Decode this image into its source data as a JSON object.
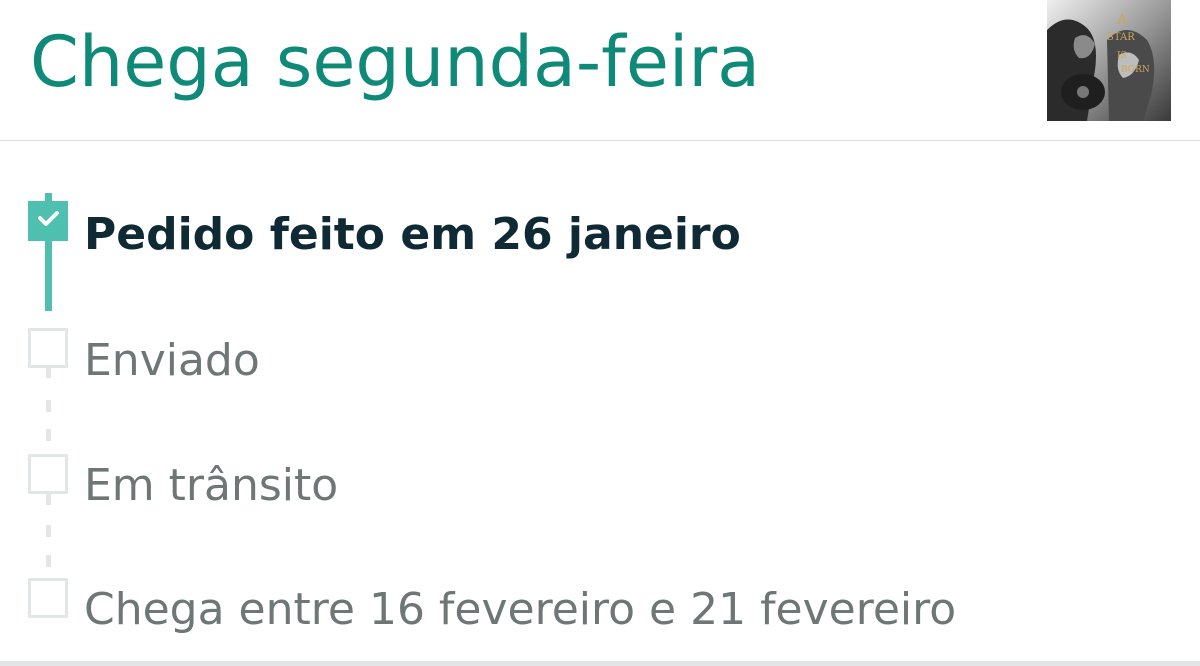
{
  "header": {
    "title": "Chega segunda-feira",
    "thumbnail_icon": "album-cover-thumbnail"
  },
  "timeline": {
    "steps": [
      {
        "label": "Pedido feito em 26 janeiro",
        "status": "done"
      },
      {
        "label": "Enviado",
        "status": "pending"
      },
      {
        "label": "Em trânsito",
        "status": "pending"
      },
      {
        "label": "Chega entre 16 fevereiro e 21 fevereiro",
        "status": "pending"
      }
    ]
  },
  "colors": {
    "title": "#0f8a78",
    "accent": "#4fbfb0",
    "active_text": "#0f2a34",
    "muted_text": "#6e7676",
    "pending_border": "#e3e6e6"
  }
}
